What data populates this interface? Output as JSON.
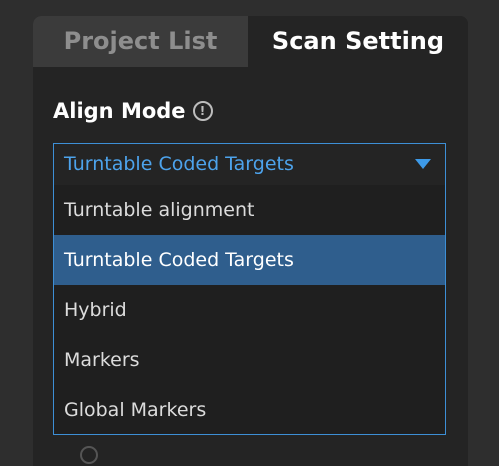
{
  "tabs": {
    "project_list": "Project List",
    "scan_setting": "Scan Setting"
  },
  "align_mode": {
    "title": "Align Mode",
    "info_icon": "info-icon",
    "selected_value": "Turntable Coded Targets",
    "options": [
      {
        "label": "Turntable alignment",
        "selected": false
      },
      {
        "label": "Turntable Coded Targets",
        "selected": true
      },
      {
        "label": "Hybrid",
        "selected": false
      },
      {
        "label": "Markers",
        "selected": false
      },
      {
        "label": "Global Markers",
        "selected": false
      }
    ]
  },
  "colors": {
    "accent": "#3d8fd6",
    "selected_bg": "#2f5e8d",
    "panel_bg": "#242424",
    "inactive_tab_bg": "#3b3b3b"
  }
}
